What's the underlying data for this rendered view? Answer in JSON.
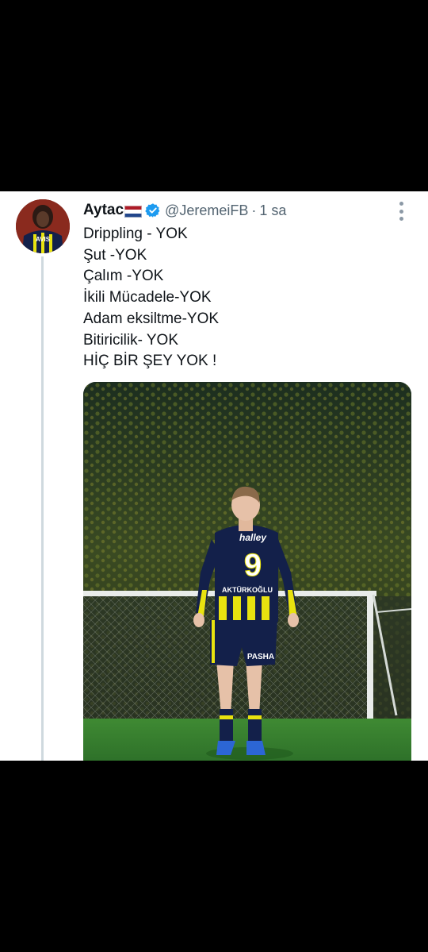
{
  "tweet": {
    "author_name": "Aytac",
    "flag_icon": "netherlands-flag-icon",
    "verified_icon": "verified-badge-icon",
    "handle": "@JeremeiFB",
    "separator": "·",
    "time": "1 sa",
    "lines": [
      "Drippling - YOK",
      "Şut -YOK",
      "Çalım -YOK",
      "İkili Mücadele-YOK",
      "Adam eksiltme-YOK",
      "Bitiricilik- YOK",
      "HİÇ BİR ŞEY YOK !"
    ],
    "avatar_text": "AVIS",
    "media": {
      "jersey_number": "9",
      "jersey_sponsor": "halley",
      "jersey_name": "AKTÜRKOĞLU",
      "shorts_sponsor": "PASHA"
    }
  },
  "colors": {
    "verified": "#1d9bf0",
    "jersey_navy": "#13204a",
    "jersey_yellow": "#e8e20f",
    "pitch": "#2f7a2c",
    "secondary_text": "#536471"
  }
}
